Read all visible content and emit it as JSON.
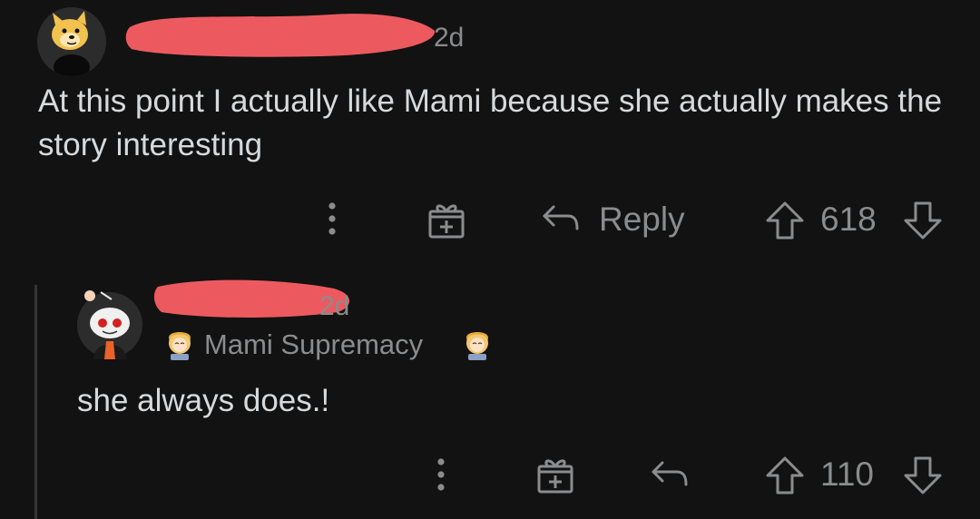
{
  "colors": {
    "background": "#121212",
    "text_primary": "#d7dadc",
    "text_secondary": "#8a8c8e",
    "redaction": "#ec5a5f",
    "thread_line": "#343536"
  },
  "comments": [
    {
      "avatar_icon": "doge-avatar-icon",
      "time": "2d",
      "body": "At this point I actually like Mami because she actually makes the story interesting",
      "actions": {
        "more_icon": "more-vertical-icon",
        "award_icon": "gift-award-icon",
        "reply_icon": "reply-arrow-icon",
        "reply_label": "Reply",
        "upvote_icon": "arrow-up-icon",
        "score": "618",
        "downvote_icon": "arrow-down-icon"
      }
    },
    {
      "avatar_icon": "snoo-avatar-icon",
      "time": "2d",
      "flair": "Mami Supremacy",
      "flair_icon": "mami-flair-icon",
      "body": "she always does.!",
      "actions": {
        "more_icon": "more-vertical-icon",
        "award_icon": "gift-award-icon",
        "reply_icon": "reply-arrow-icon",
        "upvote_icon": "arrow-up-icon",
        "score": "110",
        "downvote_icon": "arrow-down-icon"
      }
    }
  ]
}
